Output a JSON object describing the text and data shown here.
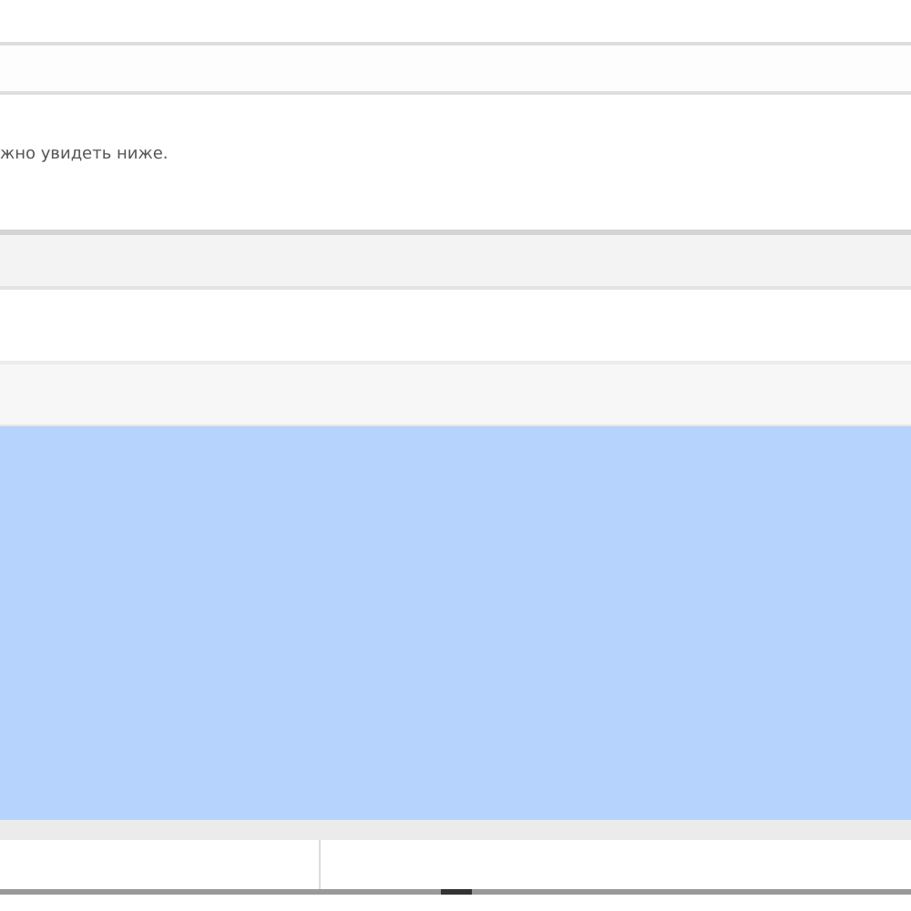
{
  "message": {
    "text": "жно увидеть ниже."
  }
}
